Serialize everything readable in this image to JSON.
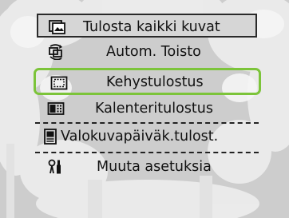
{
  "menu": {
    "items": [
      {
        "label": "Tulosta kaikki kuvat",
        "icon": "print-all-images-icon",
        "selected_highlight": false,
        "boxed": true
      },
      {
        "label": "Autom. Toisto",
        "icon": "auto-repeat-icon",
        "selected_highlight": false
      },
      {
        "label": "Kehystulostus",
        "icon": "frame-print-icon",
        "selected_highlight": true
      },
      {
        "label": "Kalenteritulostus",
        "icon": "calendar-print-icon",
        "selected_highlight": false
      },
      {
        "label": "Valokuvapäiväk.tulost.",
        "icon": "photo-diary-print-icon",
        "selected_highlight": false
      },
      {
        "label": "Muuta asetuksia",
        "icon": "settings-tools-icon",
        "selected_highlight": false
      }
    ]
  },
  "colors": {
    "highlight": "#7cc43a",
    "background": "#cfcfcf",
    "text": "#111111"
  }
}
